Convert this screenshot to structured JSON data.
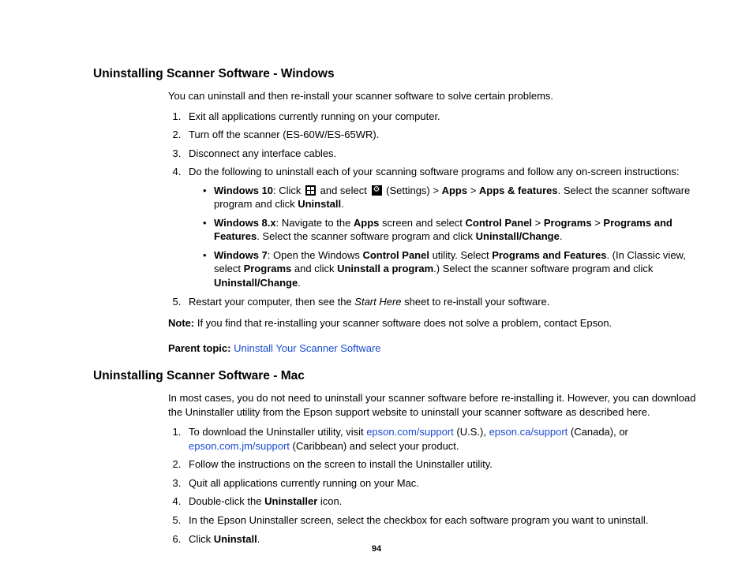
{
  "page_number": "94",
  "windows": {
    "heading": "Uninstalling Scanner Software - Windows",
    "intro": "You can uninstall and then re-install your scanner software to solve certain problems.",
    "steps": {
      "s1": "Exit all applications currently running on your computer.",
      "s2": "Turn off the scanner (ES-60W/ES-65WR).",
      "s3": "Disconnect any interface cables.",
      "s4": "Do the following to uninstall each of your scanning software programs and follow any on-screen instructions:",
      "s5_pre": "Restart your computer, then see the ",
      "s5_italic": "Start Here",
      "s5_post": " sheet to re-install your software."
    },
    "sub": {
      "w10": {
        "label": "Windows 10",
        "t1": ": Click ",
        "t2": " and select ",
        "t3": " (Settings) > ",
        "b1": "Apps",
        "t4": " > ",
        "b2": "Apps & features",
        "t5": ". Select the scanner software program and click ",
        "b3": "Uninstall",
        "t6": "."
      },
      "w8": {
        "label": "Windows 8.x",
        "t1": ": Navigate to the ",
        "b1": "Apps",
        "t2": " screen and select ",
        "b2": "Control Panel",
        "t3": " > ",
        "b3": "Programs",
        "t4": " > ",
        "b4": "Programs and Features",
        "t5": ". Select the scanner software program and click ",
        "b5": "Uninstall/Change",
        "t6": "."
      },
      "w7": {
        "label": "Windows 7",
        "t1": ": Open the Windows ",
        "b1": "Control Panel",
        "t2": " utility. Select ",
        "b2": "Programs and Features",
        "t3": ". (In Classic view, select ",
        "b3": "Programs",
        "t4": " and click ",
        "b4": "Uninstall a program",
        "t5": ".) Select the scanner software program and click ",
        "b5": "Uninstall/Change",
        "t6": "."
      }
    },
    "note_label": "Note:",
    "note_text": " If you find that re-installing your scanner software does not solve a problem, contact Epson.",
    "parent_label": "Parent topic:",
    "parent_link": "Uninstall Your Scanner Software"
  },
  "mac": {
    "heading": "Uninstalling Scanner Software - Mac",
    "intro": "In most cases, you do not need to uninstall your scanner software before re-installing it. However, you can download the Uninstaller utility from the Epson support website to uninstall your scanner software as described here.",
    "steps": {
      "s1_pre": "To download the Uninstaller utility, visit ",
      "s1_l1": "epson.com/support",
      "s1_mid1": " (U.S.), ",
      "s1_l2": "epson.ca/support",
      "s1_mid2": " (Canada), or ",
      "s1_l3": "epson.com.jm/support",
      "s1_post": " (Caribbean) and select your product.",
      "s2": "Follow the instructions on the screen to install the Uninstaller utility.",
      "s3": "Quit all applications currently running on your Mac.",
      "s4_pre": "Double-click the ",
      "s4_b": "Uninstaller",
      "s4_post": " icon.",
      "s5": "In the Epson Uninstaller screen, select the checkbox for each software program you want to uninstall.",
      "s6_pre": "Click ",
      "s6_b": "Uninstall",
      "s6_post": "."
    }
  }
}
